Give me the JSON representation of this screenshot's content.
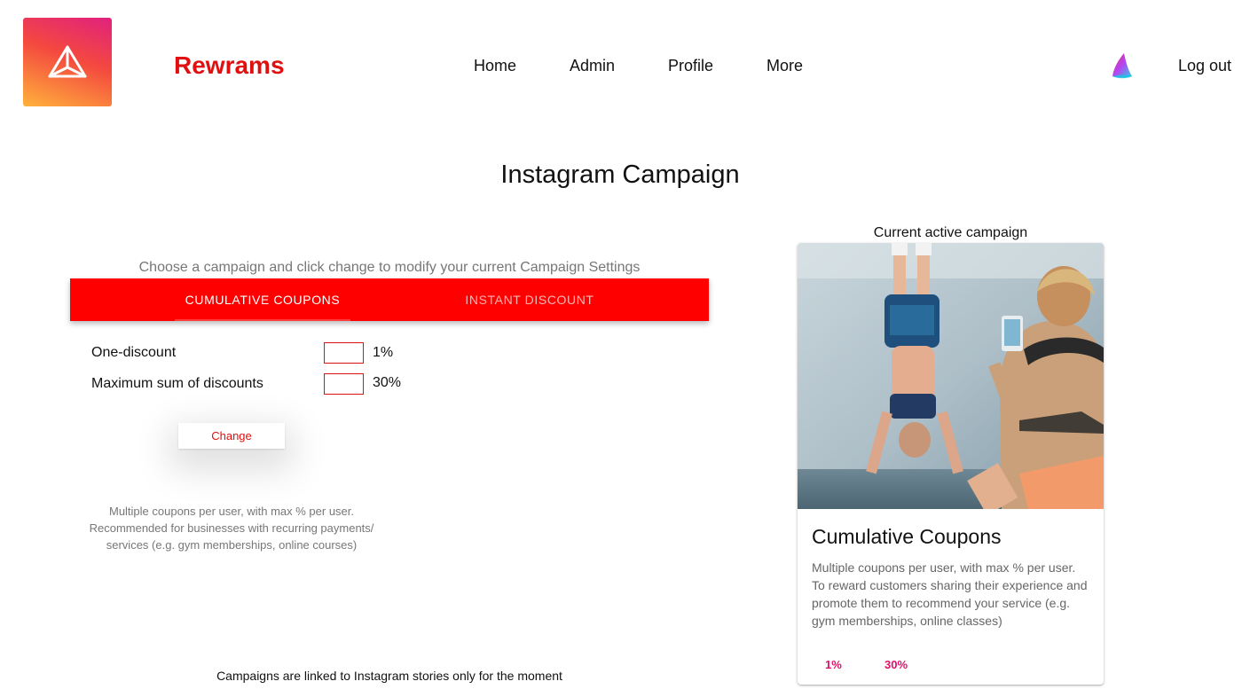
{
  "header": {
    "brand": "Rewrams",
    "nav": [
      {
        "label": "Home"
      },
      {
        "label": "Admin"
      },
      {
        "label": "Profile"
      },
      {
        "label": "More"
      }
    ],
    "logout_label": "Log out"
  },
  "page": {
    "title": "Instagram Campaign"
  },
  "campaign_form": {
    "instruction": "Choose a campaign and click change to modify your current Campaign Settings",
    "tabs": [
      {
        "label": "CUMULATIVE COUPONS",
        "selected": true
      },
      {
        "label": "INSTANT DISCOUNT",
        "selected": false
      }
    ],
    "fields": [
      {
        "label": "One-discount",
        "input_value": "",
        "value": "1%"
      },
      {
        "label": "Maximum sum of discounts",
        "input_value": "",
        "value": "30%"
      }
    ],
    "change_label": "Change",
    "description": "Multiple coupons per user, with max % per user. Recommended for businesses with recurring payments/ services (e.g. gym memberships, online courses)",
    "footer_note": "Campaigns are linked to Instagram stories only for the moment"
  },
  "active_campaign": {
    "heading": "Current active campaign",
    "title": "Cumulative Coupons",
    "description": "Multiple coupons per user, with max % per user. To reward customers sharing their experience and promote them to recommend your service (e.g. gym memberships, online classes)",
    "stats": [
      "1%",
      "30%"
    ]
  },
  "colors": {
    "brand_red": "#e01010",
    "tab_bar": "#ff0000",
    "stat_pink": "#e0106a"
  },
  "icons": {
    "logo": "triangle-logo-icon",
    "header_icon": "brand-swoosh-icon"
  }
}
